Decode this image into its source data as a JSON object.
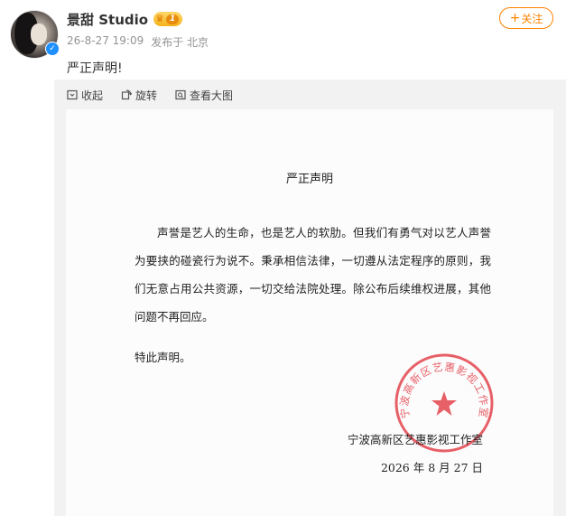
{
  "post": {
    "username": "景甜 Studio",
    "vip_level": "1",
    "timestamp": "26-8-27 19:09",
    "source": "发布于 北京",
    "text": "严正声明!"
  },
  "actions": {
    "follow": "关注"
  },
  "toolbar": {
    "collapse": "收起",
    "rotate": "旋转",
    "view_large": "查看大图"
  },
  "document": {
    "title": "严正声明",
    "body": "声誉是艺人的生命，也是艺人的软肋。但我们有勇气对以艺人声誉为要挟的碰瓷行为说不。秉承相信法律，一切遵从法定程序的原则，我们无意占用公共资源，一切交给法院处理。除公布后续维权进展，其他问题不再回应。",
    "closing": "特此声明。",
    "issuer": "宁波高新区艺惠影视工作室",
    "date": "2026 年 8 月 27 日",
    "seal_text": "宁波高新区艺惠影视工作室"
  },
  "colors": {
    "accent": "#ff8200",
    "seal": "#e0323c",
    "verified": "#1e90ff"
  }
}
